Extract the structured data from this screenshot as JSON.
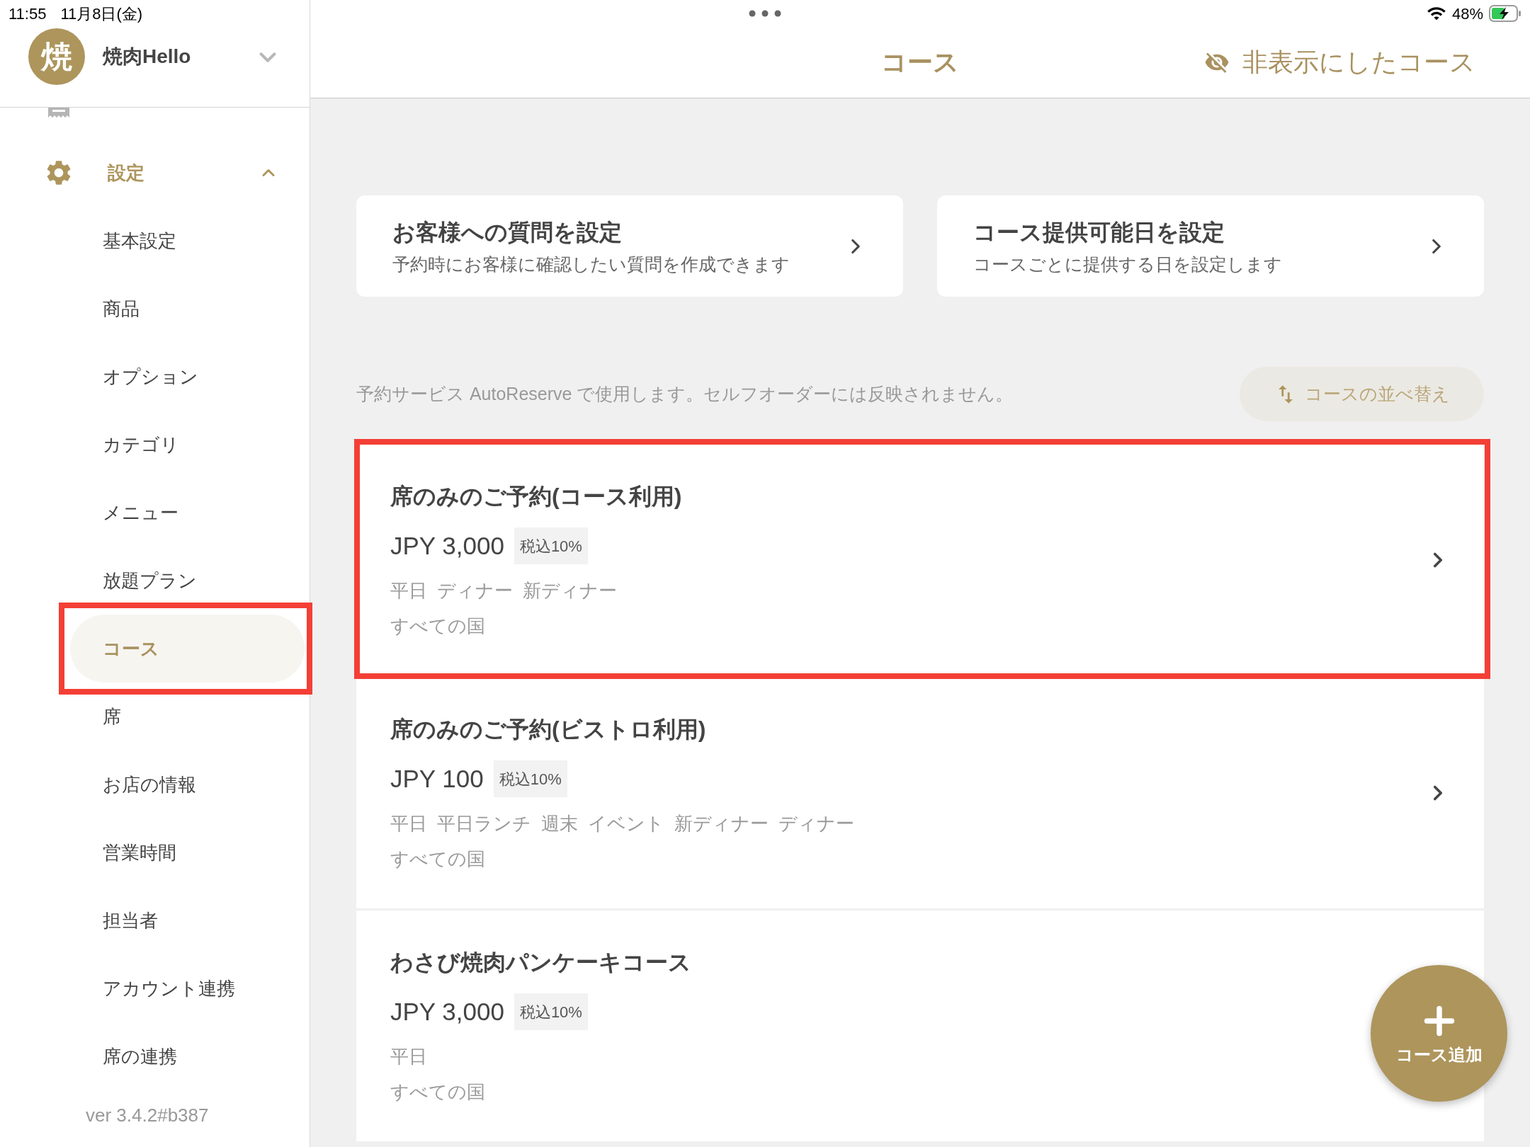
{
  "status_bar": {
    "time": "11:55",
    "date": "11月8日(金)",
    "battery": "48%"
  },
  "sidebar": {
    "store": {
      "avatar": "焼",
      "name": "焼肉Hello"
    },
    "section": {
      "label": "設定",
      "expanded": true,
      "items": [
        {
          "label": "基本設定",
          "selected": false,
          "highlighted": false
        },
        {
          "label": "商品",
          "selected": false,
          "highlighted": false
        },
        {
          "label": "オプション",
          "selected": false,
          "highlighted": false
        },
        {
          "label": "カテゴリ",
          "selected": false,
          "highlighted": false
        },
        {
          "label": "メニュー",
          "selected": false,
          "highlighted": false
        },
        {
          "label": "放題プラン",
          "selected": false,
          "highlighted": false
        },
        {
          "label": "コース",
          "selected": true,
          "highlighted": true
        },
        {
          "label": "席",
          "selected": false,
          "highlighted": false
        },
        {
          "label": "お店の情報",
          "selected": false,
          "highlighted": false
        },
        {
          "label": "営業時間",
          "selected": false,
          "highlighted": false
        },
        {
          "label": "担当者",
          "selected": false,
          "highlighted": false
        },
        {
          "label": "アカウント連携",
          "selected": false,
          "highlighted": false
        },
        {
          "label": "席の連携",
          "selected": false,
          "highlighted": false
        }
      ]
    },
    "version": "ver 3.4.2#b387"
  },
  "header": {
    "title": "コース",
    "hidden_link": "非表示にしたコース"
  },
  "settings_cards": [
    {
      "title": "お客様への質問を設定",
      "subtitle": "予約時にお客様に確認したい質問を作成できます"
    },
    {
      "title": "コース提供可能日を設定",
      "subtitle": "コースごとに提供する日を設定します"
    }
  ],
  "note": "予約サービス AutoReserve で使用します。セルフオーダーには反映されません。",
  "sort_button": "コースの並べ替え",
  "courses": [
    {
      "name": "席のみのご予約(コース利用)",
      "price": "JPY 3,000",
      "tax": "税込10%",
      "tags": [
        "平日",
        "ディナー",
        "新ディナー"
      ],
      "countries": "すべての国",
      "highlighted": true
    },
    {
      "name": "席のみのご予約(ビストロ利用)",
      "price": "JPY 100",
      "tax": "税込10%",
      "tags": [
        "平日",
        "平日ランチ",
        "週末",
        "イベント",
        "新ディナー",
        "ディナー"
      ],
      "countries": "すべての国",
      "highlighted": false
    },
    {
      "name": "わさび焼肉パンケーキコース",
      "price": "JPY 3,000",
      "tax": "税込10%",
      "tags": [
        "平日"
      ],
      "countries": "すべての国",
      "highlighted": false
    }
  ],
  "fab": {
    "label": "コース追加"
  }
}
